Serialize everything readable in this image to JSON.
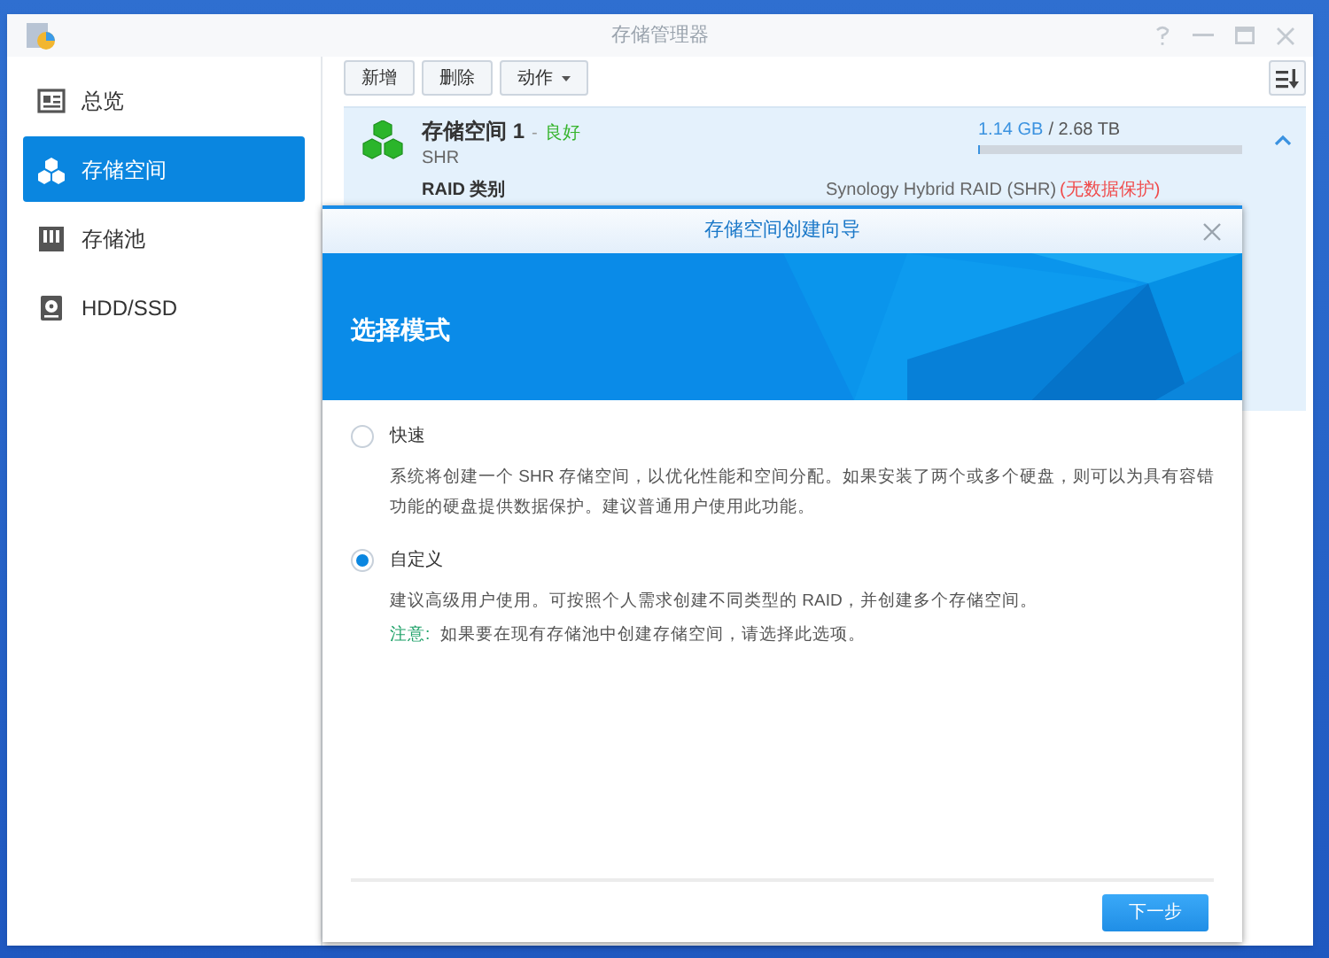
{
  "window": {
    "title": "存储管理器"
  },
  "sidebar": {
    "items": [
      {
        "label": "总览",
        "kind": "overview",
        "selected": false
      },
      {
        "label": "存储空间",
        "kind": "volume",
        "selected": true
      },
      {
        "label": "存储池",
        "kind": "pool",
        "selected": false
      },
      {
        "label": "HDD/SSD",
        "kind": "disk",
        "selected": false
      }
    ]
  },
  "toolbar": {
    "buttons": [
      {
        "label": "新增",
        "kind": "plain"
      },
      {
        "label": "删除",
        "kind": "plain"
      },
      {
        "label": "动作",
        "kind": "dropdown"
      }
    ]
  },
  "volume": {
    "name": "存储空间 1",
    "separator": "-",
    "status": "良好",
    "type": "SHR",
    "used": "1.14 GB",
    "total": "/ 2.68 TB",
    "level": 0.004,
    "expanded": true,
    "raid_label": "RAID 类别",
    "raid_value": "Synology Hybrid RAID (SHR)",
    "raid_warning": "(无数据保护)"
  },
  "dialog": {
    "title": "存储空间创建向导",
    "heading": "选择模式",
    "options": [
      {
        "label": "快速",
        "selected": false,
        "description": "系统将创建一个 SHR 存储空间，以优化性能和空间分配。如果安装了两个或多个硬盘，则可以为具有容错功能的硬盘提供数据保护。建议普通用户使用此功能。"
      },
      {
        "label": "自定义",
        "selected": true,
        "description": "建议高级用户使用。可按照个人需求创建不同类型的 RAID，并创建多个存储空间。",
        "note_label": "注意:",
        "note": "如果要在现有存储池中创建存储空间，请选择此选项。"
      }
    ],
    "next_button": "下一步"
  }
}
